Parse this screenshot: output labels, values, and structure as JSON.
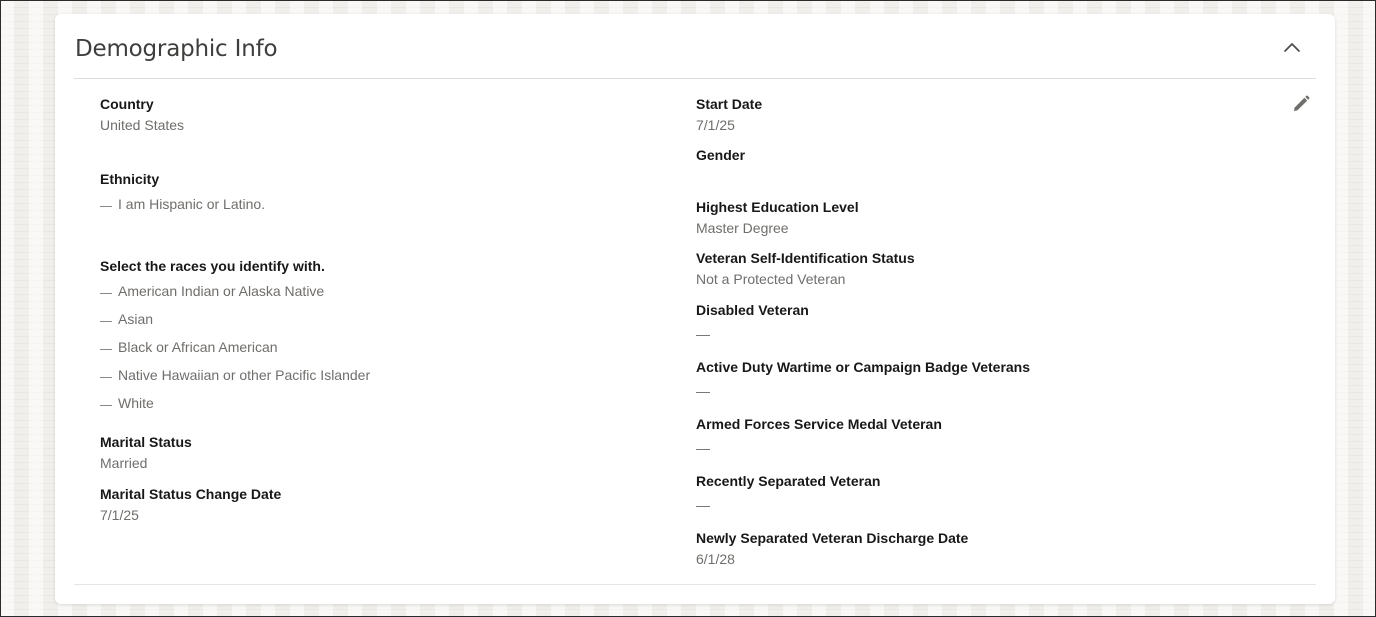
{
  "section": {
    "title": "Demographic Info"
  },
  "left": {
    "country": {
      "label": "Country",
      "value": "United States"
    },
    "ethnicity": {
      "label": "Ethnicity",
      "options": [
        "I am Hispanic or Latino."
      ]
    },
    "races": {
      "label": "Select the races you identify with.",
      "options": [
        "American Indian or Alaska Native",
        "Asian",
        "Black or African American",
        "Native Hawaiian or other Pacific Islander",
        "White"
      ]
    },
    "marital_status": {
      "label": "Marital Status",
      "value": "Married"
    },
    "marital_status_change_date": {
      "label": "Marital Status Change Date",
      "value": "7/1/25"
    }
  },
  "right": {
    "start_date": {
      "label": "Start Date",
      "value": "7/1/25"
    },
    "gender": {
      "label": "Gender",
      "value": ""
    },
    "highest_education": {
      "label": "Highest Education Level",
      "value": "Master Degree"
    },
    "veteran_status": {
      "label": "Veteran Self-Identification Status",
      "value": "Not a Protected Veteran"
    },
    "disabled_veteran": {
      "label": "Disabled Veteran",
      "value": "—"
    },
    "active_duty": {
      "label": "Active Duty Wartime or Campaign Badge Veterans",
      "value": "—"
    },
    "armed_forces": {
      "label": "Armed Forces Service Medal Veteran",
      "value": "—"
    },
    "recently_separated": {
      "label": "Recently Separated Veteran",
      "value": "—"
    },
    "discharge_date": {
      "label": "Newly Separated Veteran Discharge Date",
      "value": "6/1/28"
    }
  },
  "icons": {
    "collapse": "chevron-up-icon",
    "edit": "pencil-icon"
  },
  "colors": {
    "label": "#181818",
    "value": "#706e6b",
    "card": "#ffffff",
    "background": "#f1efeb"
  }
}
